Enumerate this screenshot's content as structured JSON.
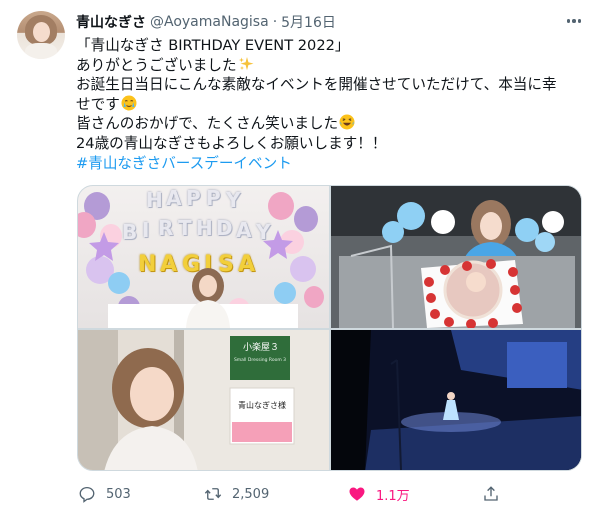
{
  "tweet": {
    "display_name": "青山なぎさ",
    "handle": "@AoyamaNagisa",
    "separator": "·",
    "date": "5月16日",
    "lines": [
      "「青山なぎさ BIRTHDAY EVENT 2022」",
      "ありがとうございました",
      "お誕生日当日にこんな素敵なイベントを開催させていただけて、本当に幸",
      "せです",
      "皆さんのおかげで、たくさん笑いました",
      "24歳の青山なぎさもよろしくお願いします！！"
    ],
    "hashtag": "#青山なぎさバースデーイベント",
    "emoji": [
      "sparkles-emoji",
      "crying-emoji",
      "laughing-emoji"
    ]
  },
  "media": {
    "photo1": {
      "balloon_letters_top": [
        "H",
        "A",
        "P",
        "P",
        "Y"
      ],
      "balloon_letters_mid": [
        "B",
        "I",
        "R",
        "T",
        "H",
        "D",
        "A",
        "Y"
      ],
      "balloon_letters_name": [
        "N",
        "A",
        "G",
        "I",
        "S",
        "A"
      ]
    },
    "photo3": {
      "sign_room": "小楽屋３",
      "sign_room_sub": "Small Dressing Room 3",
      "sign_name": "青山なぎさ様"
    }
  },
  "actions": {
    "reply_count": "503",
    "retweet_count": "2,509",
    "like_count": "1.1万",
    "icons": [
      "reply-icon",
      "retweet-icon",
      "like-icon",
      "share-icon"
    ]
  },
  "colors": {
    "accent": "#1d9bf0",
    "like": "#f91880",
    "muted": "#536471"
  }
}
